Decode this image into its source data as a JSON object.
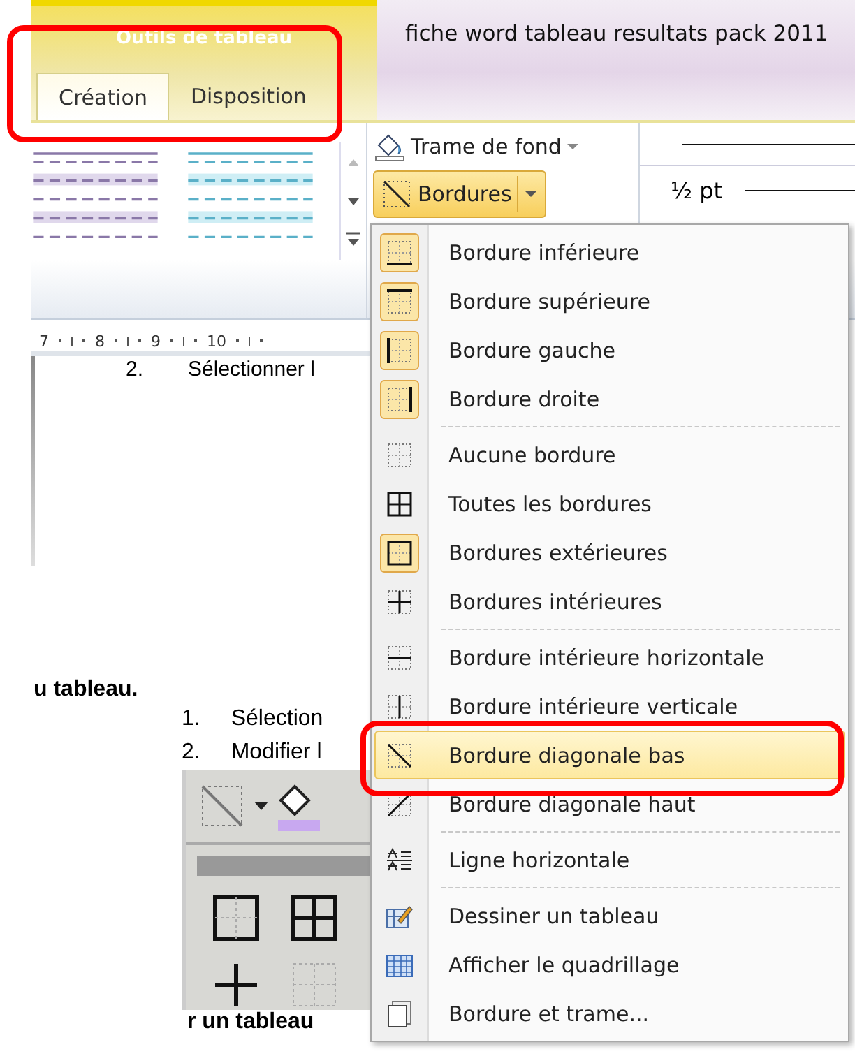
{
  "contextual_group": {
    "title": "Outils de tableau"
  },
  "tabs": [
    {
      "label": "Création",
      "selected": true
    },
    {
      "label": "Disposition",
      "selected": false
    }
  ],
  "window": {
    "title": "fiche word tableau resultats pack 2011"
  },
  "ribbon": {
    "shading_button": {
      "label": "Trame de fond"
    },
    "borders_button": {
      "label": "Bordures",
      "selected": true
    },
    "pen_weight": "½ pt"
  },
  "ruler": {
    "marks": [
      "7",
      "8",
      "9",
      "10"
    ]
  },
  "document": {
    "partial_step": {
      "number": "2.",
      "text": "Sélectionner l"
    },
    "heading": "u tableau.",
    "steps": [
      {
        "number": "1.",
        "text": "Sélection"
      },
      {
        "number": "2.",
        "text": "Modifier l"
      }
    ],
    "footer_text": "r un tableau"
  },
  "menu": {
    "groups": [
      {
        "items": [
          {
            "label": "Bordure inférieure",
            "kind": "bottom",
            "checked": true,
            "selected": false
          },
          {
            "label": "Bordure supérieure",
            "kind": "top",
            "checked": true,
            "selected": false
          },
          {
            "label": "Bordure gauche",
            "kind": "left",
            "checked": true,
            "selected": false
          },
          {
            "label": "Bordure droite",
            "kind": "right",
            "checked": true,
            "selected": false
          }
        ]
      },
      {
        "items": [
          {
            "label": "Aucune bordure",
            "kind": "none",
            "checked": false,
            "selected": false
          },
          {
            "label": "Toutes les bordures",
            "kind": "all",
            "checked": false,
            "selected": false
          },
          {
            "label": "Bordures extérieures",
            "kind": "outside",
            "checked": true,
            "selected": false
          },
          {
            "label": "Bordures intérieures",
            "kind": "inside",
            "checked": false,
            "selected": false
          }
        ]
      },
      {
        "items": [
          {
            "label": "Bordure intérieure horizontale",
            "kind": "inside-h",
            "checked": false,
            "selected": false
          },
          {
            "label": "Bordure intérieure verticale",
            "kind": "inside-v",
            "checked": false,
            "selected": false
          },
          {
            "label": "Bordure diagonale bas",
            "kind": "diag-down",
            "checked": false,
            "selected": true
          },
          {
            "label": "Bordure diagonale haut",
            "kind": "diag-up",
            "checked": false,
            "selected": false
          }
        ]
      },
      {
        "items": [
          {
            "label": "Ligne horizontale",
            "kind": "hline",
            "checked": false,
            "selected": false
          }
        ]
      },
      {
        "items": [
          {
            "label": "Dessiner un tableau",
            "kind": "draw",
            "checked": false,
            "selected": false
          },
          {
            "label": "Afficher le quadrillage",
            "kind": "grid",
            "checked": false,
            "selected": false
          },
          {
            "label": "Bordure et trame...",
            "kind": "dialog",
            "checked": false,
            "selected": false
          }
        ]
      }
    ]
  }
}
